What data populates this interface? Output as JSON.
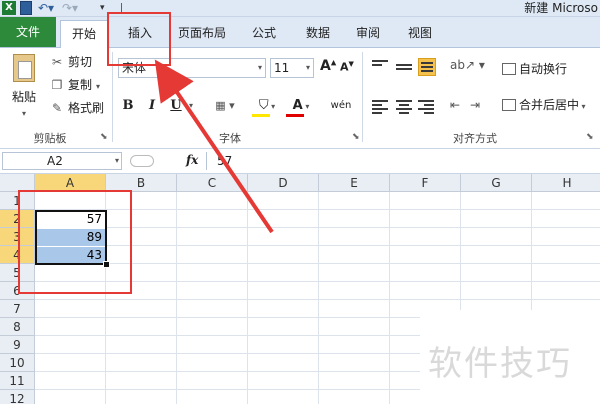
{
  "titlebar": {
    "app_icon": "X",
    "window_title": "新建 Microso"
  },
  "tabs": [
    {
      "id": "file",
      "label": "文件"
    },
    {
      "id": "home",
      "label": "开始"
    },
    {
      "id": "insert",
      "label": "插入"
    },
    {
      "id": "page_layout",
      "label": "页面布局"
    },
    {
      "id": "formulas",
      "label": "公式"
    },
    {
      "id": "data",
      "label": "数据"
    },
    {
      "id": "review",
      "label": "审阅"
    },
    {
      "id": "view",
      "label": "视图"
    }
  ],
  "clipboard": {
    "paste_label": "粘贴",
    "cut_label": "剪切",
    "copy_label": "复制",
    "format_painter_label": "格式刷",
    "group_label": "剪贴板"
  },
  "font": {
    "name": "宋体",
    "size": "11",
    "bold": "B",
    "italic": "I",
    "underline": "U",
    "font_color_glyph": "A",
    "phonetic_glyph": "wén",
    "group_label": "字体",
    "fill_color": "#ffe700",
    "font_color": "#e00000"
  },
  "alignment": {
    "wrap_text_label": "自动换行",
    "merge_center_label": "合并后居中",
    "group_label": "对齐方式"
  },
  "formula_bar": {
    "name_box": "A2",
    "fx": "fx",
    "value": "57"
  },
  "sheet": {
    "columns": [
      "A",
      "B",
      "C",
      "D",
      "E",
      "F",
      "G",
      "H"
    ],
    "rows": [
      "1",
      "2",
      "3",
      "4",
      "5",
      "6",
      "7",
      "8",
      "9",
      "10",
      "11",
      "12"
    ],
    "cells": {
      "A2": "57",
      "A3": "89",
      "A4": "43"
    },
    "selected_range": "A2:A4",
    "active_cell": "A2",
    "highlight_color": "#a9c7e8"
  },
  "watermark": {
    "text": "软件技巧"
  },
  "annotation_color": "#e53935"
}
